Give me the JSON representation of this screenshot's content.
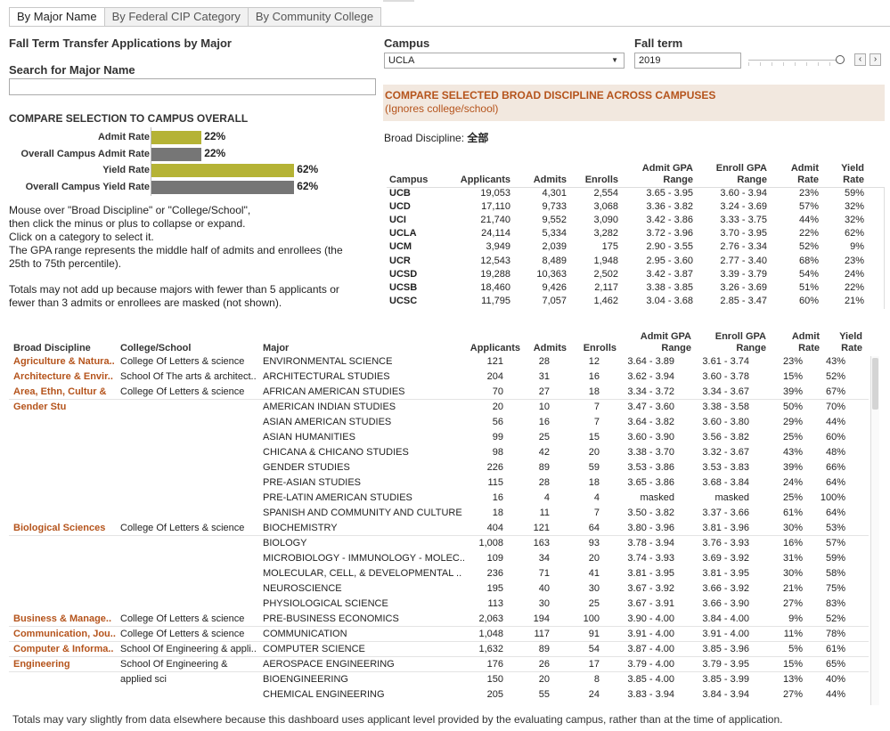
{
  "tabs": [
    {
      "label": "By Major Name",
      "active": true
    },
    {
      "label": "By Federal CIP Category",
      "active": false
    },
    {
      "label": "By Community College",
      "active": false
    }
  ],
  "left": {
    "title": "Fall Term Transfer Applications by Major",
    "search_label": "Search for Major Name",
    "search_value": "",
    "compare_title": "COMPARE SELECTION TO CAMPUS OVERALL",
    "bars": [
      {
        "label": "Admit Rate",
        "value": 22,
        "display": "22%",
        "color": "#b5b335"
      },
      {
        "label": "Overall Campus Admit Rate",
        "value": 22,
        "display": "22%",
        "color": "#767676"
      },
      {
        "label": "Yield Rate",
        "value": 62,
        "display": "62%",
        "color": "#b5b335"
      },
      {
        "label": "Overall Campus Yield Rate",
        "value": 62,
        "display": "62%",
        "color": "#767676"
      }
    ],
    "notes": [
      "Mouse over \"Broad Discipline\" or \"College/School\",",
      "then click the minus or plus to collapse or expand.",
      "Click on a category to select it.",
      "The GPA range represents the middle half of admits and enrollees (the",
      "25th to 75th percentile)."
    ],
    "notes2": [
      "Totals may not add up because majors with fewer than 5 applicants or",
      "fewer than 3 admits or enrollees are masked (not shown)."
    ]
  },
  "filters": {
    "campus_label": "Campus",
    "campus_value": "UCLA",
    "term_label": "Fall term",
    "term_value": "2019"
  },
  "compare": {
    "title": "COMPARE SELECTED BROAD DISCIPLINE ACROSS CAMPUSES",
    "subtitle": "(Ignores college/school)",
    "broad_label": "Broad Discipline: ",
    "broad_value": "全部"
  },
  "campus_table": {
    "headers": [
      "Campus",
      "Applicants",
      "Admits",
      "Enrolls",
      "Admit GPA|Range",
      "Enroll GPA|Range",
      "Admit|Rate",
      "Yield|Rate"
    ],
    "rows": [
      [
        "UCB",
        "19,053",
        "4,301",
        "2,554",
        "3.65 - 3.95",
        "3.60 - 3.94",
        "23%",
        "59%"
      ],
      [
        "UCD",
        "17,110",
        "9,733",
        "3,068",
        "3.36 - 3.82",
        "3.24 - 3.69",
        "57%",
        "32%"
      ],
      [
        "UCI",
        "21,740",
        "9,552",
        "3,090",
        "3.42 - 3.86",
        "3.33 - 3.75",
        "44%",
        "32%"
      ],
      [
        "UCLA",
        "24,114",
        "5,334",
        "3,282",
        "3.72 - 3.96",
        "3.70 - 3.95",
        "22%",
        "62%"
      ],
      [
        "UCM",
        "3,949",
        "2,039",
        "175",
        "2.90 - 3.55",
        "2.76 - 3.34",
        "52%",
        "9%"
      ],
      [
        "UCR",
        "12,543",
        "8,489",
        "1,948",
        "2.95 - 3.60",
        "2.77 - 3.40",
        "68%",
        "23%"
      ],
      [
        "UCSD",
        "19,288",
        "10,363",
        "2,502",
        "3.42 - 3.87",
        "3.39 - 3.79",
        "54%",
        "24%"
      ],
      [
        "UCSB",
        "18,460",
        "9,426",
        "2,117",
        "3.38 - 3.85",
        "3.26 - 3.69",
        "51%",
        "22%"
      ],
      [
        "UCSC",
        "11,795",
        "7,057",
        "1,462",
        "3.04 - 3.68",
        "2.85 - 3.47",
        "60%",
        "21%"
      ]
    ]
  },
  "major_table": {
    "headers": [
      "Broad Discipline",
      "College/School",
      "Major",
      "Applicants",
      "Admits",
      "Enrolls",
      "Admit GPA|Range",
      "Enroll GPA|Range",
      "Admit|Rate",
      "Yield|Rate"
    ],
    "rows": [
      [
        "Agriculture & Natura..",
        "College Of Letters & science",
        "ENVIRONMENTAL SCIENCE",
        "121",
        "28",
        "12",
        "3.64 - 3.89",
        "3.61 - 3.74",
        "23%",
        "43%"
      ],
      [
        "Architecture & Envir..",
        "School Of The arts & architect..",
        "ARCHITECTURAL STUDIES",
        "204",
        "31",
        "16",
        "3.62 - 3.94",
        "3.60 - 3.78",
        "15%",
        "52%"
      ],
      [
        "Area, Ethn, Cultur &",
        "College Of Letters & science",
        "AFRICAN AMERICAN STUDIES",
        "70",
        "27",
        "18",
        "3.34 - 3.72",
        "3.34 - 3.67",
        "39%",
        "67%"
      ],
      [
        "Gender Stu",
        "",
        "AMERICAN INDIAN STUDIES",
        "20",
        "10",
        "7",
        "3.47 - 3.60",
        "3.38 - 3.58",
        "50%",
        "70%"
      ],
      [
        "",
        "",
        "ASIAN AMERICAN STUDIES",
        "56",
        "16",
        "7",
        "3.64 - 3.82",
        "3.60 - 3.80",
        "29%",
        "44%"
      ],
      [
        "",
        "",
        "ASIAN HUMANITIES",
        "99",
        "25",
        "15",
        "3.60 - 3.90",
        "3.56 - 3.82",
        "25%",
        "60%"
      ],
      [
        "",
        "",
        "CHICANA & CHICANO STUDIES",
        "98",
        "42",
        "20",
        "3.38 - 3.70",
        "3.32 - 3.67",
        "43%",
        "48%"
      ],
      [
        "",
        "",
        "GENDER STUDIES",
        "226",
        "89",
        "59",
        "3.53 - 3.86",
        "3.53 - 3.83",
        "39%",
        "66%"
      ],
      [
        "",
        "",
        "PRE-ASIAN STUDIES",
        "115",
        "28",
        "18",
        "3.65 - 3.86",
        "3.68 - 3.84",
        "24%",
        "64%"
      ],
      [
        "",
        "",
        "PRE-LATIN AMERICAN STUDIES",
        "16",
        "4",
        "4",
        "masked",
        "masked",
        "25%",
        "100%"
      ],
      [
        "",
        "",
        "SPANISH AND COMMUNITY AND CULTURE",
        "18",
        "11",
        "7",
        "3.50 - 3.82",
        "3.37 - 3.66",
        "61%",
        "64%"
      ],
      [
        "Biological Sciences",
        "College Of Letters & science",
        "BIOCHEMISTRY",
        "404",
        "121",
        "64",
        "3.80 - 3.96",
        "3.81 - 3.96",
        "30%",
        "53%"
      ],
      [
        "",
        "",
        "BIOLOGY",
        "1,008",
        "163",
        "93",
        "3.78 - 3.94",
        "3.76 - 3.93",
        "16%",
        "57%"
      ],
      [
        "",
        "",
        "MICROBIOLOGY - IMMUNOLOGY - MOLEC..",
        "109",
        "34",
        "20",
        "3.74 - 3.93",
        "3.69 - 3.92",
        "31%",
        "59%"
      ],
      [
        "",
        "",
        "MOLECULAR, CELL, & DEVELOPMENTAL ..",
        "236",
        "71",
        "41",
        "3.81 - 3.95",
        "3.81 - 3.95",
        "30%",
        "58%"
      ],
      [
        "",
        "",
        "NEUROSCIENCE",
        "195",
        "40",
        "30",
        "3.67 - 3.92",
        "3.66 - 3.92",
        "21%",
        "75%"
      ],
      [
        "",
        "",
        "PHYSIOLOGICAL SCIENCE",
        "113",
        "30",
        "25",
        "3.67 - 3.91",
        "3.66 - 3.90",
        "27%",
        "83%"
      ],
      [
        "Business & Manage..",
        "College Of Letters & science",
        "PRE-BUSINESS ECONOMICS",
        "2,063",
        "194",
        "100",
        "3.90 - 4.00",
        "3.84 - 4.00",
        "9%",
        "52%"
      ],
      [
        "Communication, Jou..",
        "College Of Letters & science",
        "COMMUNICATION",
        "1,048",
        "117",
        "91",
        "3.91 - 4.00",
        "3.91 - 4.00",
        "11%",
        "78%"
      ],
      [
        "Computer & Informa..",
        "School Of Engineering & appli..",
        "COMPUTER SCIENCE",
        "1,632",
        "89",
        "54",
        "3.87 - 4.00",
        "3.85 - 3.96",
        "5%",
        "61%"
      ],
      [
        "Engineering",
        "School Of Engineering &",
        "AEROSPACE ENGINEERING",
        "176",
        "26",
        "17",
        "3.79 - 4.00",
        "3.79 - 3.95",
        "15%",
        "65%"
      ],
      [
        "",
        "applied sci",
        "BIOENGINEERING",
        "150",
        "20",
        "8",
        "3.85 - 4.00",
        "3.85 - 3.99",
        "13%",
        "40%"
      ],
      [
        "",
        "",
        "CHEMICAL ENGINEERING",
        "205",
        "55",
        "24",
        "3.83 - 3.94",
        "3.84 - 3.94",
        "27%",
        "44%"
      ]
    ],
    "separators_after": [
      2,
      11,
      17,
      18,
      19,
      20
    ]
  },
  "footer": "Totals may vary slightly from data elsewhere because this dashboard uses applicant level provided by the evaluating campus, rather than at the time of application.",
  "colors": {
    "accent": "#b5541c",
    "bar_selected": "#b5b335",
    "bar_overall": "#767676",
    "banner": "#f2e8df"
  }
}
